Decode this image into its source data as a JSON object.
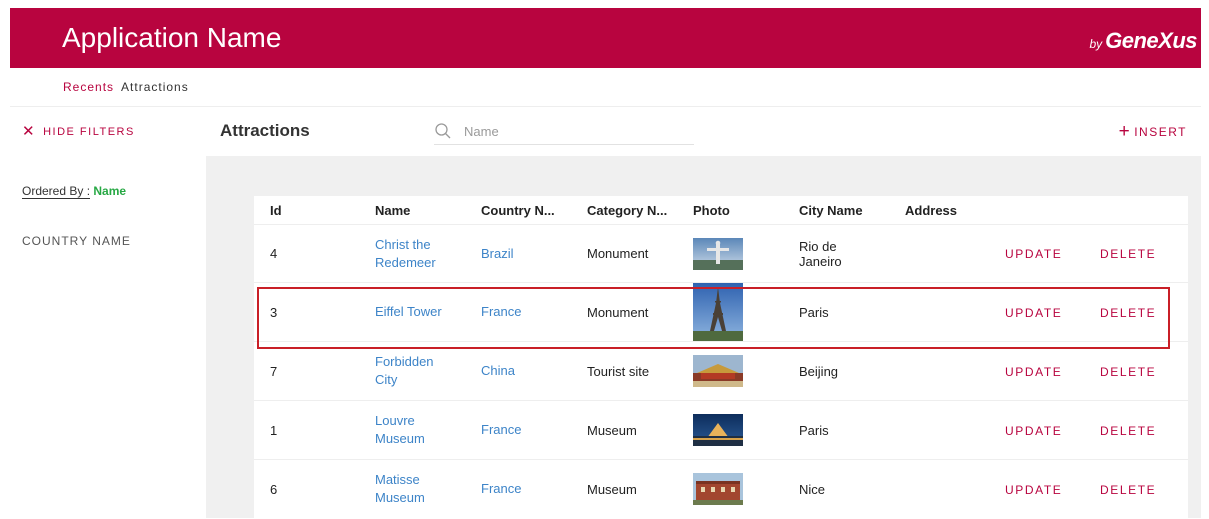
{
  "header": {
    "app_name": "Application Name",
    "brand_by": "by",
    "brand_name": "GeneXus"
  },
  "breadcrumb": {
    "items": [
      "Recents",
      "Attractions"
    ]
  },
  "toolbar": {
    "hide_filters_label": "HIDE FILTERS",
    "page_title": "Attractions",
    "search_placeholder": "Name",
    "insert_label": "INSERT"
  },
  "sidebar": {
    "ordered_by_label": "Ordered By :",
    "ordered_by_value": "Name",
    "filter_label": "COUNTRY NAME"
  },
  "grid": {
    "columns": [
      "Id",
      "Name",
      "Country N...",
      "Category N...",
      "Photo",
      "City Name",
      "Address"
    ],
    "update_label": "UPDATE",
    "delete_label": "DELETE",
    "rows": [
      {
        "id": "4",
        "name_line1": "Christ the",
        "name_line2": "Redemeer",
        "country": "Brazil",
        "category": "Monument",
        "photo": "christ-redeemer-photo",
        "city_line1": "Rio de",
        "city_line2": "Janeiro",
        "address": ""
      },
      {
        "id": "3",
        "name_line1": "Eiffel Tower",
        "name_line2": "",
        "country": "France",
        "category": "Monument",
        "photo": "eiffel-tower-photo",
        "city_line1": "Paris",
        "city_line2": "",
        "address": ""
      },
      {
        "id": "7",
        "name_line1": "Forbidden",
        "name_line2": "City",
        "country": "China",
        "category": "Tourist site",
        "photo": "forbidden-city-photo",
        "city_line1": "Beijing",
        "city_line2": "",
        "address": ""
      },
      {
        "id": "1",
        "name_line1": "Louvre",
        "name_line2": "Museum",
        "country": "France",
        "category": "Museum",
        "photo": "louvre-museum-photo",
        "city_line1": "Paris",
        "city_line2": "",
        "address": ""
      },
      {
        "id": "6",
        "name_line1": "Matisse",
        "name_line2": "Museum",
        "country": "France",
        "category": "Museum",
        "photo": "matisse-museum-photo",
        "city_line1": "Nice",
        "city_line2": "",
        "address": ""
      }
    ]
  },
  "colors": {
    "brand": "#b8043f",
    "link": "#3d84c8",
    "accent_green": "#27a844",
    "highlight": "#c91f27"
  }
}
